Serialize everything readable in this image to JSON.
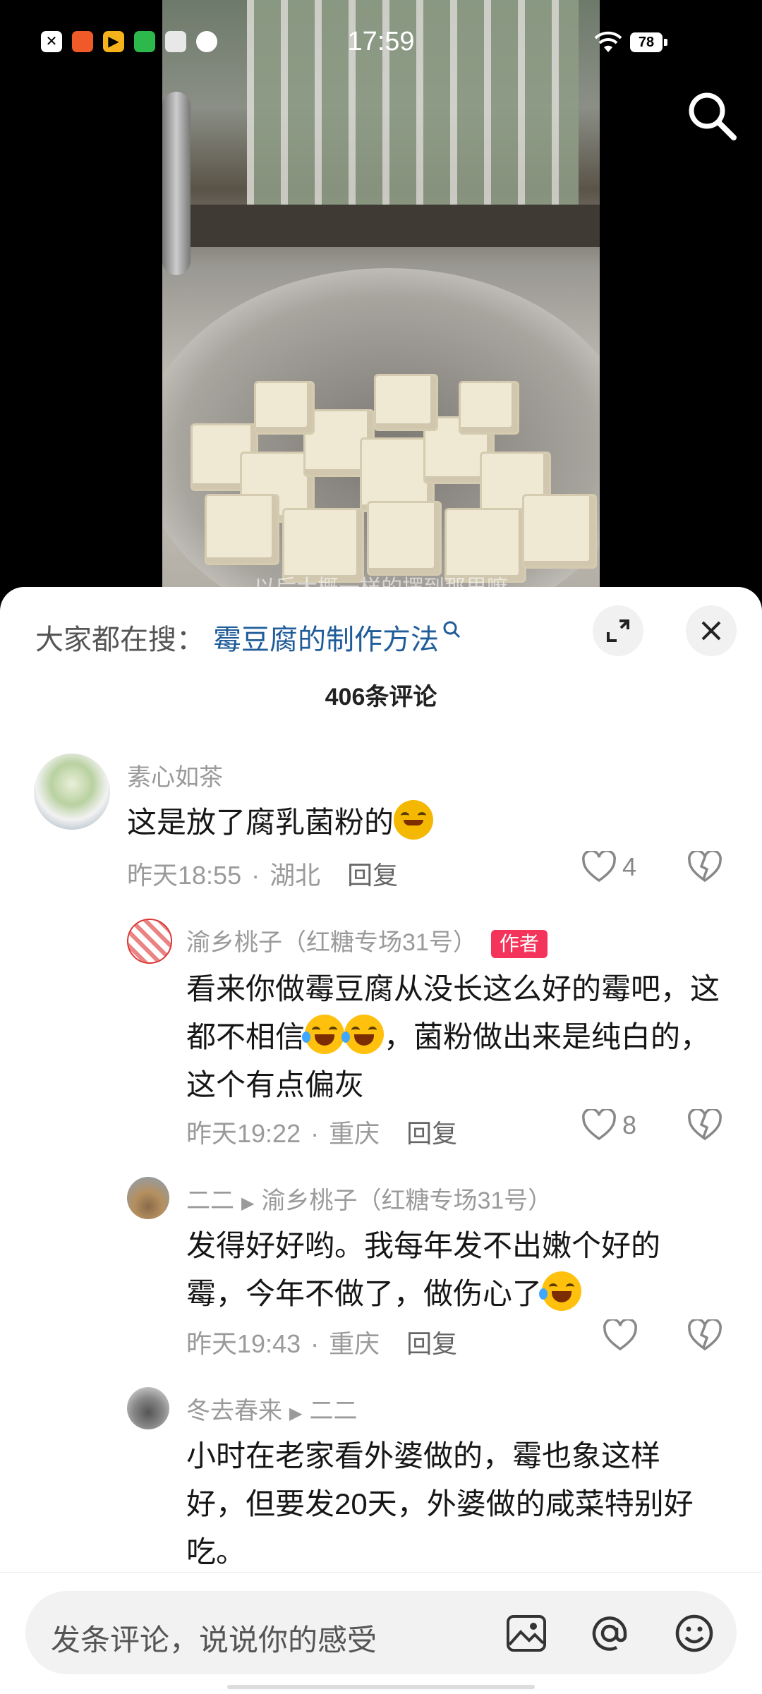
{
  "status_bar": {
    "time": "17:59",
    "battery": "78",
    "notification_icons": [
      "close-app-icon",
      "shop-app-icon",
      "video-app-icon",
      "chat-app-icon",
      "doc-app-icon",
      "browser-app-icon"
    ]
  },
  "video": {
    "subtitle": "以后大概一样的摆到那里嘛"
  },
  "sheet": {
    "search_prefix": "大家都在搜：",
    "search_term": "霉豆腐的制作方法",
    "comment_count": "406条评论"
  },
  "comments": [
    {
      "name": "素心如茶",
      "text": "这是放了腐乳菌粉的",
      "time": "昨天18:55",
      "location": "湖北",
      "reply": "回复",
      "likes": "4"
    },
    {
      "name": "渝乡桃子（红糖专场31号）",
      "badge": "作者",
      "text_before_emoji": "看来你做霉豆腐从没长这么好的霉吧，这都不相信",
      "text_after_emoji": "，菌粉做出来是纯白的，这个有点偏灰",
      "time": "昨天19:22",
      "location": "重庆",
      "reply": "回复",
      "likes": "8"
    },
    {
      "name": "二二",
      "reply_to": "渝乡桃子（红糖专场31号）",
      "text": "发得好好哟。我每年发不出嫩个好的霉，今年不做了，做伤心了",
      "time": "昨天19:43",
      "location": "重庆",
      "reply": "回复"
    },
    {
      "name": "冬去春来",
      "reply_to": "二二",
      "text": "小时在老家看外婆做的，霉也象这样好，但要发20天，外婆做的咸菜特别好吃。"
    }
  ],
  "input": {
    "placeholder": "发条评论，说说你的感受"
  },
  "colors": {
    "search_term": "#1f5c99",
    "author_badge": "#f4345a"
  }
}
